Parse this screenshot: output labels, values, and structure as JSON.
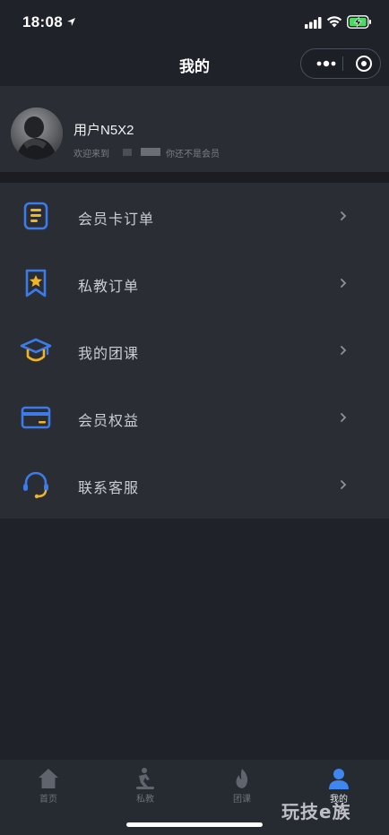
{
  "status_bar": {
    "time": "18:08"
  },
  "nav": {
    "title": "我的"
  },
  "profile": {
    "username": "用户N5X2",
    "welcome_prefix": "欢迎来到",
    "welcome_suffix": "你还不是会员"
  },
  "menu": [
    {
      "label": "会员卡订单",
      "icon": "member-card-order-icon"
    },
    {
      "label": "私教订单",
      "icon": "private-coach-order-icon"
    },
    {
      "label": "我的团课",
      "icon": "group-class-icon"
    },
    {
      "label": "会员权益",
      "icon": "member-benefits-icon"
    },
    {
      "label": "联系客服",
      "icon": "customer-service-icon"
    }
  ],
  "tabs": [
    {
      "label": "首页",
      "icon": "home-icon",
      "active": false
    },
    {
      "label": "私教",
      "icon": "private-coach-icon",
      "active": false
    },
    {
      "label": "团课",
      "icon": "group-class-flame-icon",
      "active": false
    },
    {
      "label": "我的",
      "icon": "profile-icon",
      "active": true
    }
  ],
  "watermark": "玩技e族",
  "colors": {
    "background": "#1f2229",
    "card": "#2a2d34",
    "icon_blue": "#3d7be8",
    "icon_yellow": "#f0b429",
    "active_tab": "#3f86f0"
  }
}
